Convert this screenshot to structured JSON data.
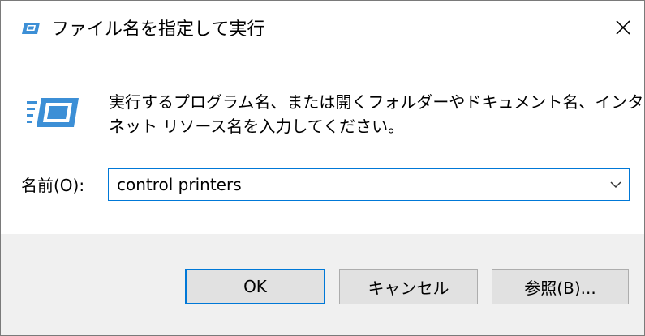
{
  "window": {
    "title": "ファイル名を指定して実行",
    "close_icon": "close-icon",
    "title_icon": "run-dialog-icon"
  },
  "main": {
    "icon": "run-program-icon",
    "description_lines": [
      "実行するプログラム名、または開くフォルダーやドキュメント名、インター",
      "ネット リソース名を入力してください。"
    ],
    "name_label": "名前(O):",
    "input_value": "control printers",
    "dropdown_icon": "chevron-down-icon"
  },
  "buttons": {
    "ok": "OK",
    "cancel": "キャンセル",
    "browse": "参照(B)..."
  },
  "colors": {
    "accent": "#0078d7",
    "footer_bg": "#f0f0f0",
    "button_bg": "#e1e1e1",
    "icon_blue": "#3c8fd6"
  }
}
